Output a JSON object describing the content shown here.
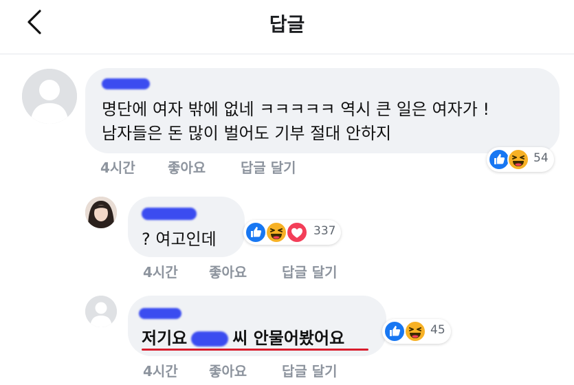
{
  "header": {
    "title": "답글"
  },
  "comments": [
    {
      "line1": "명단에 여자 밖에 없네 ㅋㅋㅋㅋㅋ 역시 큰 일은 여자가 !",
      "line2": "남자들은 돈 많이 벌어도 기부 절대 안하지",
      "time": "4시간",
      "like_label": "좋아요",
      "reply_label": "답글 달기",
      "reactions": [
        "like-icon",
        "haha-icon"
      ],
      "reaction_count": "54"
    },
    {
      "text": "? 여고인데",
      "time": "4시간",
      "like_label": "좋아요",
      "reply_label": "답글 달기",
      "reactions": [
        "like-icon",
        "haha-icon",
        "love-icon"
      ],
      "reaction_count": "337"
    },
    {
      "text_before": "저기요",
      "text_after": "씨 안물어봤어요",
      "time": "4시간",
      "like_label": "좋아요",
      "reply_label": "답글 달기",
      "reactions": [
        "like-icon",
        "haha-icon"
      ],
      "reaction_count": "45"
    }
  ],
  "colors": {
    "like": "#1877f2",
    "haha": "#f7b125",
    "love": "#f33e58",
    "underline": "#d81b2b",
    "redaction": "#3b4cf0"
  }
}
